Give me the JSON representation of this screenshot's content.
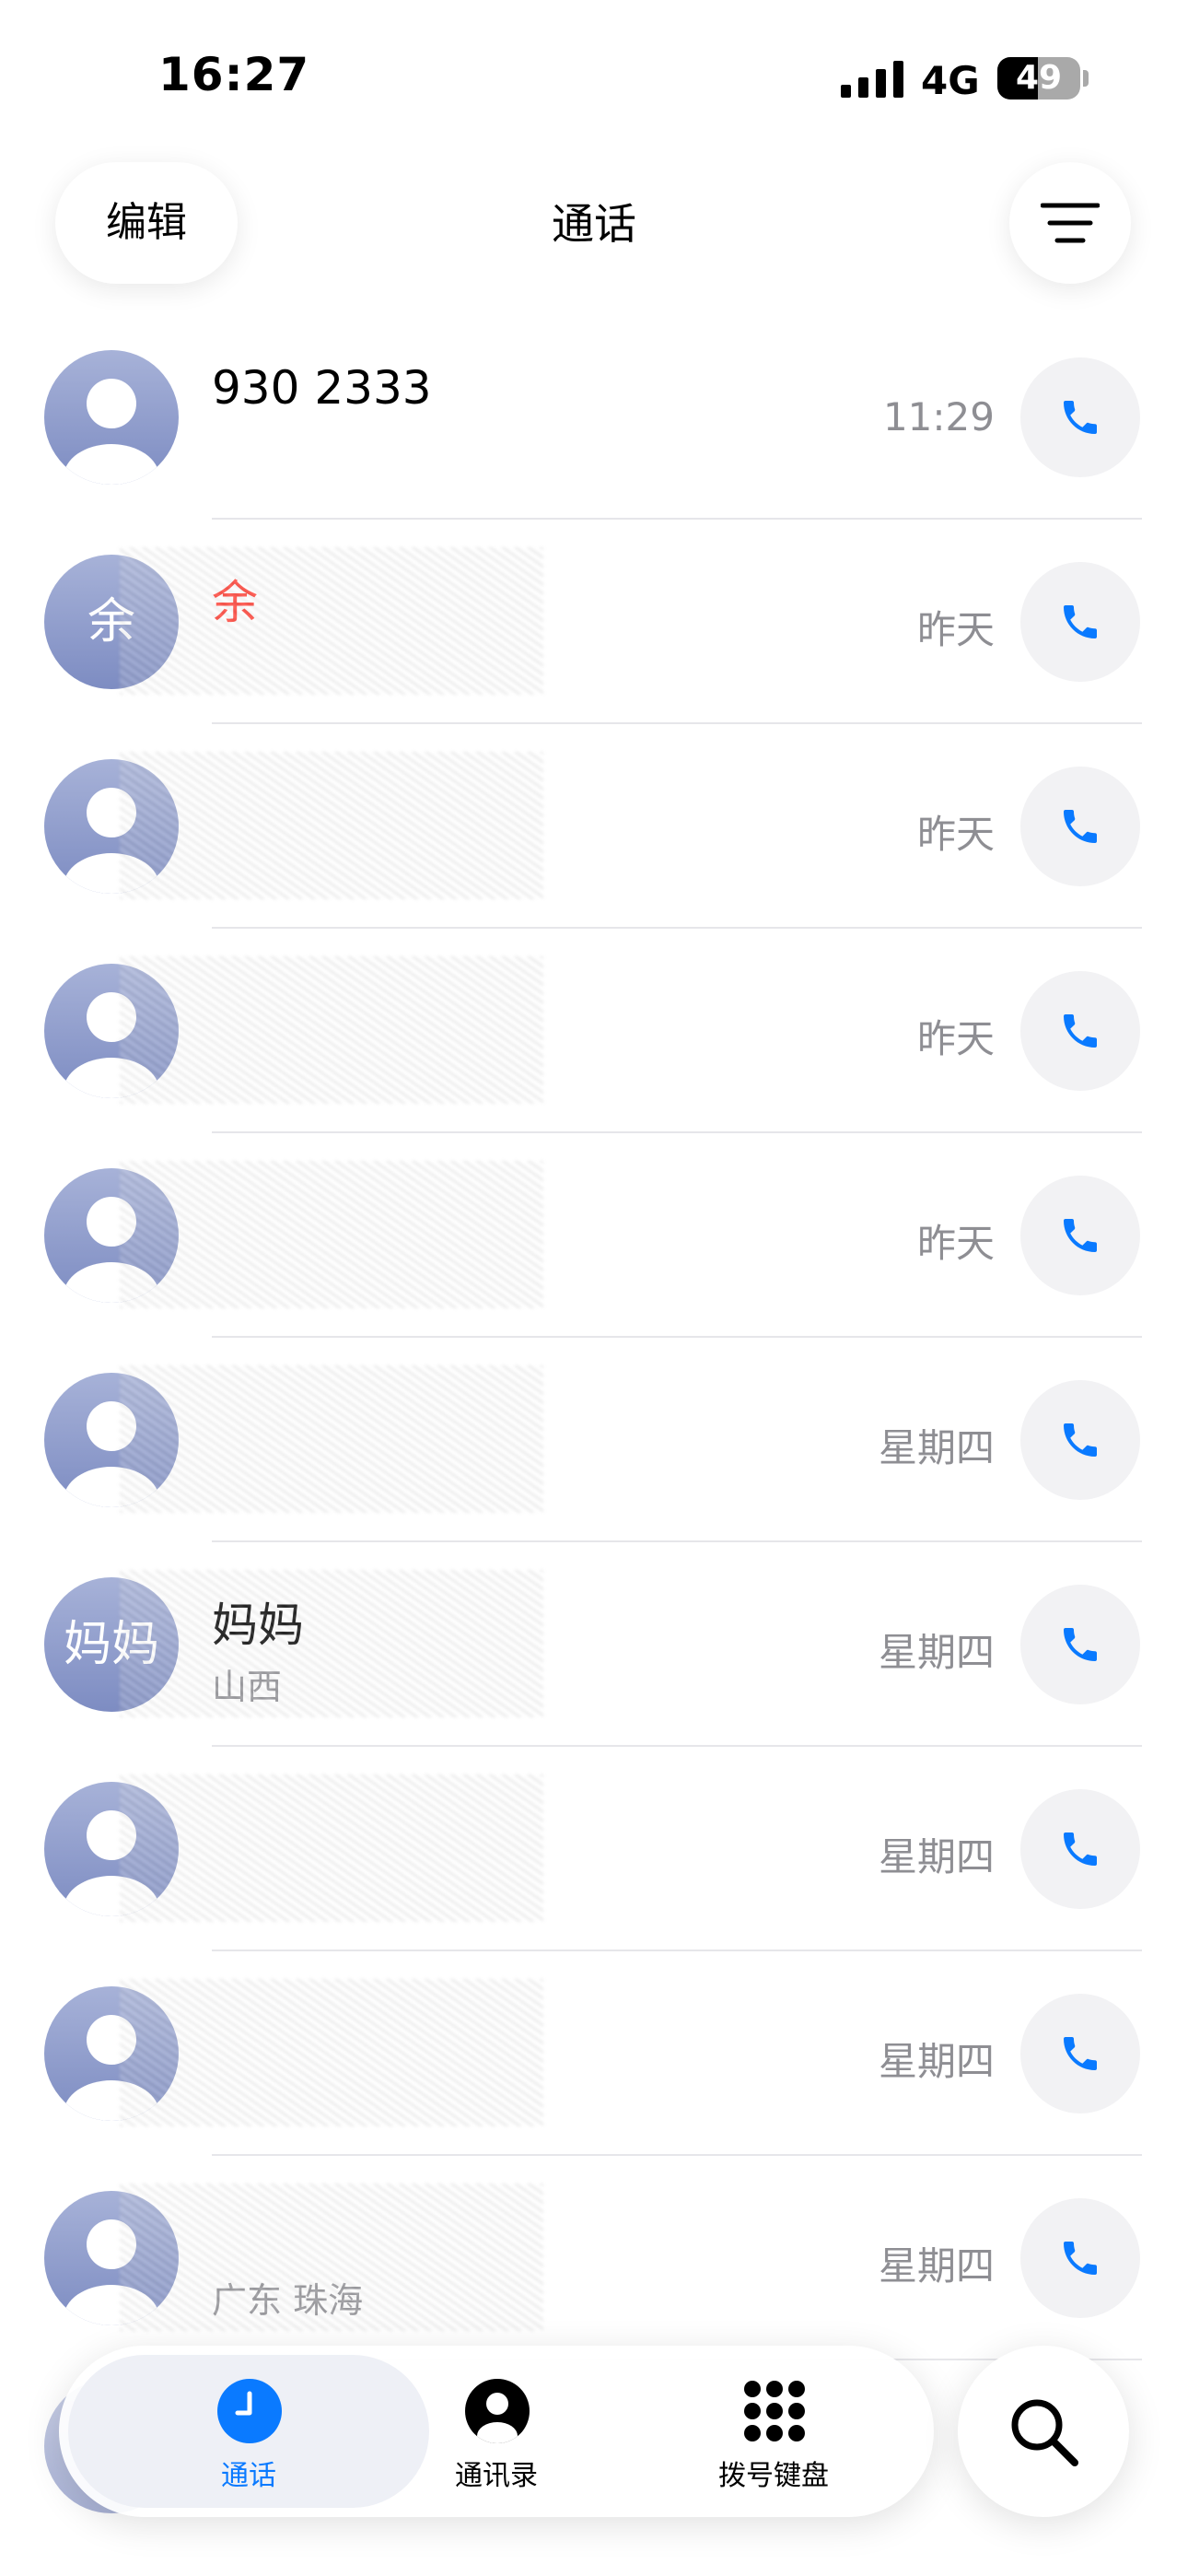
{
  "status_bar": {
    "time": "16:27",
    "network": "4G",
    "battery": "49",
    "battery_level": 0.49
  },
  "header": {
    "edit_label": "编辑",
    "title": "通话",
    "filter_icon": "filter-lines-icon"
  },
  "calls": [
    {
      "name": "930 2333",
      "subtitle": "",
      "time": "11:29",
      "avatar": "",
      "missed": false
    },
    {
      "name": "余",
      "subtitle": "",
      "time": "昨天",
      "avatar": "余",
      "missed": true
    },
    {
      "name": "",
      "subtitle": "",
      "time": "昨天",
      "avatar": "",
      "missed": false
    },
    {
      "name": "",
      "subtitle": "",
      "time": "昨天",
      "avatar": "",
      "missed": false
    },
    {
      "name": "",
      "subtitle": "",
      "time": "昨天",
      "avatar": "",
      "missed": false
    },
    {
      "name": "",
      "subtitle": "",
      "time": "星期四",
      "avatar": "",
      "missed": false
    },
    {
      "name": "妈妈",
      "subtitle": "山西",
      "time": "星期四",
      "avatar": "妈妈",
      "missed": false
    },
    {
      "name": "",
      "subtitle": "",
      "time": "星期四",
      "avatar": "",
      "missed": false
    },
    {
      "name": "",
      "subtitle": "",
      "time": "星期四",
      "avatar": "",
      "missed": false
    },
    {
      "name": "",
      "subtitle": "广东 珠海",
      "time": "星期四",
      "avatar": "",
      "missed": true
    }
  ],
  "tab_bar": {
    "tabs": [
      {
        "label": "通话",
        "icon": "clock-icon",
        "active": true
      },
      {
        "label": "通讯录",
        "icon": "person-circle-icon",
        "active": false
      },
      {
        "label": "拨号键盘",
        "icon": "keypad-icon",
        "active": false
      }
    ],
    "search_icon": "search-icon"
  },
  "colors": {
    "accent": "#0a7aff",
    "missed": "#ff3b30",
    "secondary_text": "#8e8e93",
    "call_button_bg": "#f2f2f4",
    "avatar_top": "#a7b2d8",
    "avatar_bottom": "#7d8cc2"
  }
}
